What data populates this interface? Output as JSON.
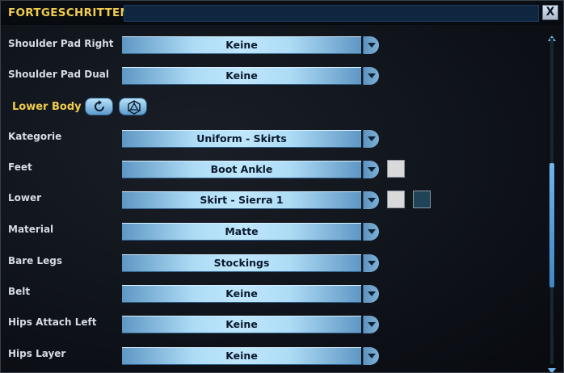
{
  "window": {
    "title": "FORTGESCHRITTEN",
    "close_glyph": "X"
  },
  "rows": [
    {
      "label": "Shoulder Pad Right",
      "value": "Keine"
    },
    {
      "label": "Shoulder Pad Dual",
      "value": "Keine"
    }
  ],
  "section": {
    "title": "Lower Body",
    "buttons": [
      "refresh-icon",
      "random-die-icon"
    ]
  },
  "section_rows": [
    {
      "label": "Kategorie",
      "value": "Uniform - Skirts"
    },
    {
      "label": "Feet",
      "value": "Boot Ankle",
      "swatches": [
        "#d9d9d9"
      ]
    },
    {
      "label": "Lower",
      "value": "Skirt - Sierra 1",
      "swatches": [
        "#d9d9d9",
        "#1f4458"
      ]
    },
    {
      "label": "Material",
      "value": "Matte"
    },
    {
      "label": "Bare Legs",
      "value": "Stockings"
    },
    {
      "label": "Belt",
      "value": "Keine"
    },
    {
      "label": "Hips Attach Left",
      "value": "Keine"
    },
    {
      "label": "Hips Layer",
      "value": "Keine"
    }
  ],
  "scrollbar": {
    "position_fraction": 0.62,
    "visible_fraction": 0.38
  },
  "colors": {
    "accent": "#f0cd4d",
    "dropdown_light": "#bfe6fb",
    "dropdown_dark": "#5f97c4"
  }
}
